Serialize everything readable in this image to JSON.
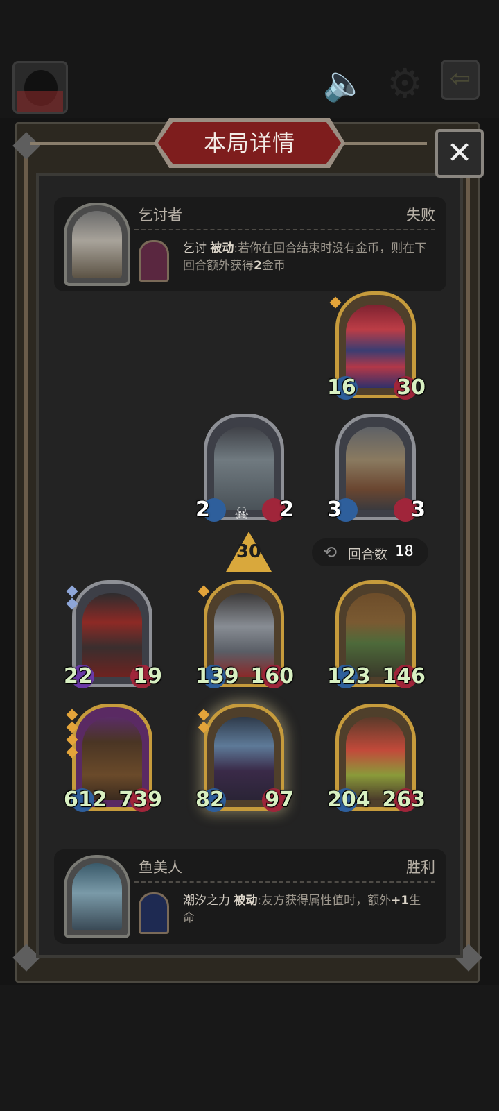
{
  "title": "本局详情",
  "close_icon": "✕",
  "enemy": {
    "name": "乞讨者",
    "result": "失败",
    "skill_name": "乞讨",
    "skill_kw": "被动",
    "skill_desc_a": ":若你在回合结束时没有金币，则在下回合额外获得",
    "skill_desc_hl": "2",
    "skill_desc_b": "金币"
  },
  "self": {
    "name": "鱼美人",
    "result": "胜利",
    "skill_name": "潮汐之力",
    "skill_kw": "被动",
    "skill_desc_a": ":友方获得属性值时，额外",
    "skill_desc_hl": "+1",
    "skill_desc_b": "生命"
  },
  "round": {
    "label": "回合数",
    "value": "18"
  },
  "boost": "30",
  "enemy_cards": [
    {
      "atk": "16",
      "hp": "30"
    },
    {
      "atk": "2",
      "hp": "2"
    },
    {
      "atk": "3",
      "hp": "3"
    }
  ],
  "player_cards": [
    {
      "atk": "22",
      "hp": "19"
    },
    {
      "atk": "139",
      "hp": "160"
    },
    {
      "atk": "123",
      "hp": "146"
    },
    {
      "atk": "612",
      "hp": "739"
    },
    {
      "atk": "82",
      "hp": "97"
    },
    {
      "atk": "204",
      "hp": "263"
    }
  ],
  "icons": {
    "speaker": "speaker-icon",
    "gear": "gear-icon",
    "exit": "exit-icon",
    "round": "cycle-icon",
    "skull": "skull-icon"
  },
  "colors": {
    "banner": "#7e1d1d",
    "gold_frame": "#c69b3c",
    "stat_green": "#d8f0c2"
  }
}
